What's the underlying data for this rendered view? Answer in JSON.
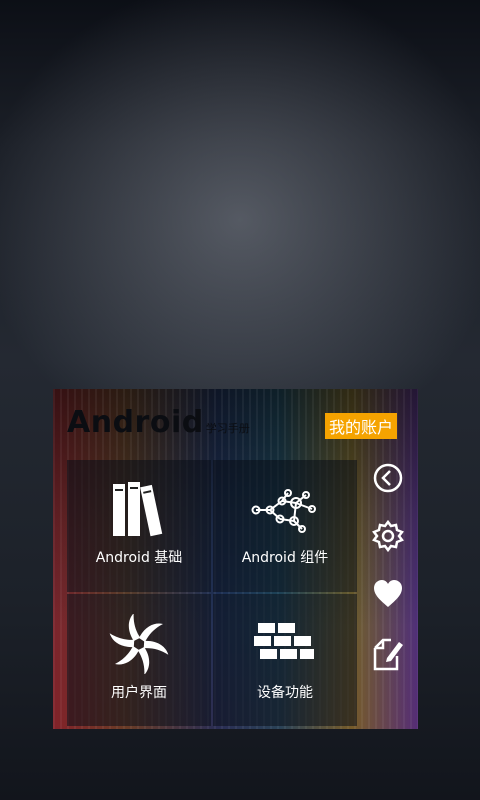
{
  "widget": {
    "brand": "Android",
    "brand_sub": "学习手册",
    "account_button": "我的账户",
    "tiles": [
      {
        "label": "Android 基础",
        "icon": "books-icon"
      },
      {
        "label": "Android 组件",
        "icon": "network-nodes-icon"
      },
      {
        "label": "用户界面",
        "icon": "swirl-icon"
      },
      {
        "label": "设备功能",
        "icon": "bricks-icon"
      }
    ],
    "side_buttons": [
      {
        "icon": "back-circle-icon"
      },
      {
        "icon": "gear-icon"
      },
      {
        "icon": "heart-icon"
      },
      {
        "icon": "note-edit-icon"
      }
    ]
  }
}
